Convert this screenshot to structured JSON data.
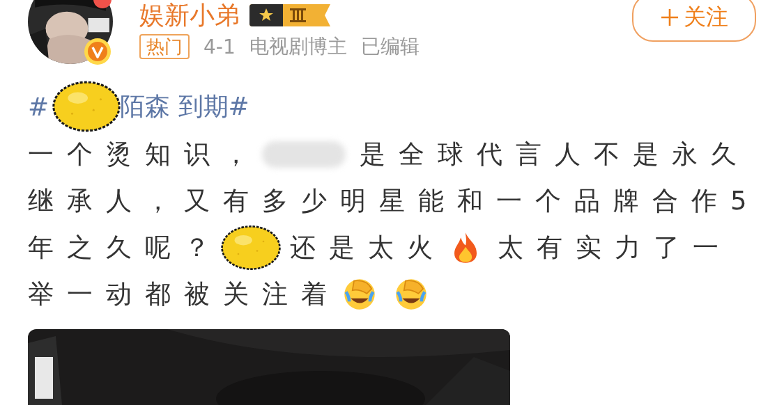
{
  "author": {
    "name": "娱新小弟",
    "verified": true
  },
  "meta": [
    {
      "kind": "tag",
      "text": "热门"
    },
    {
      "kind": "text",
      "text": "4-1"
    },
    {
      "kind": "text",
      "text": "电视剧博主"
    },
    {
      "kind": "text",
      "text": "已编辑"
    }
  ],
  "follow_button": {
    "label": "关注"
  },
  "hashtag": [
    {
      "kind": "text",
      "text": "#"
    },
    {
      "kind": "sticker"
    },
    {
      "kind": "text",
      "text": "陌森 到期#"
    }
  ],
  "body_lines": [
    [
      {
        "kind": "text",
        "text": "一个烫知识，"
      },
      {
        "kind": "blur"
      },
      {
        "kind": "text",
        "text": "是全球代言人不是永久"
      }
    ],
    [
      {
        "kind": "text",
        "text": "继承人，又有多少明星能和一个品牌合作5"
      }
    ],
    [
      {
        "kind": "text",
        "text": "年之久呢？"
      },
      {
        "kind": "sticker"
      },
      {
        "kind": "text",
        "text": "还是太火"
      },
      {
        "kind": "fire"
      },
      {
        "kind": "text",
        "text": "太有实力了一"
      }
    ],
    [
      {
        "kind": "text",
        "text": "举一动都被关注着"
      },
      {
        "kind": "facepalm"
      },
      {
        "kind": "facepalm"
      }
    ]
  ],
  "media": {
    "kind": "picture"
  }
}
